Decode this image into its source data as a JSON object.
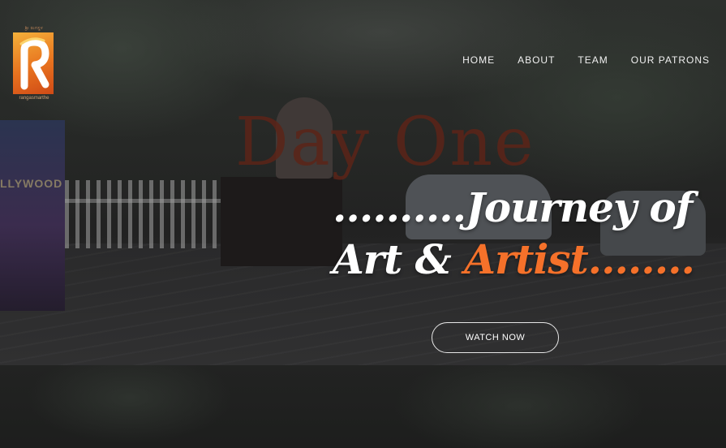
{
  "logo": {
    "top_text": "ಶ್ರೀ ರಂಗಸ್ಥಳ",
    "bottom_text": "rangasmarthe"
  },
  "nav": {
    "items": [
      {
        "label": "HOME"
      },
      {
        "label": "ABOUT"
      },
      {
        "label": "TEAM"
      },
      {
        "label": "OUR PATRONS"
      }
    ]
  },
  "hero": {
    "background_text": "Day One",
    "stand_text": "LLYWOOD",
    "headline_line1": "..........Journey of",
    "headline_line2_white": "Art & ",
    "headline_line2_accent": "Artist........",
    "watch_label": "WATCH NOW"
  },
  "colors": {
    "accent": "#f5712a",
    "text": "#ffffff",
    "logo_orange": "#e8731f"
  }
}
